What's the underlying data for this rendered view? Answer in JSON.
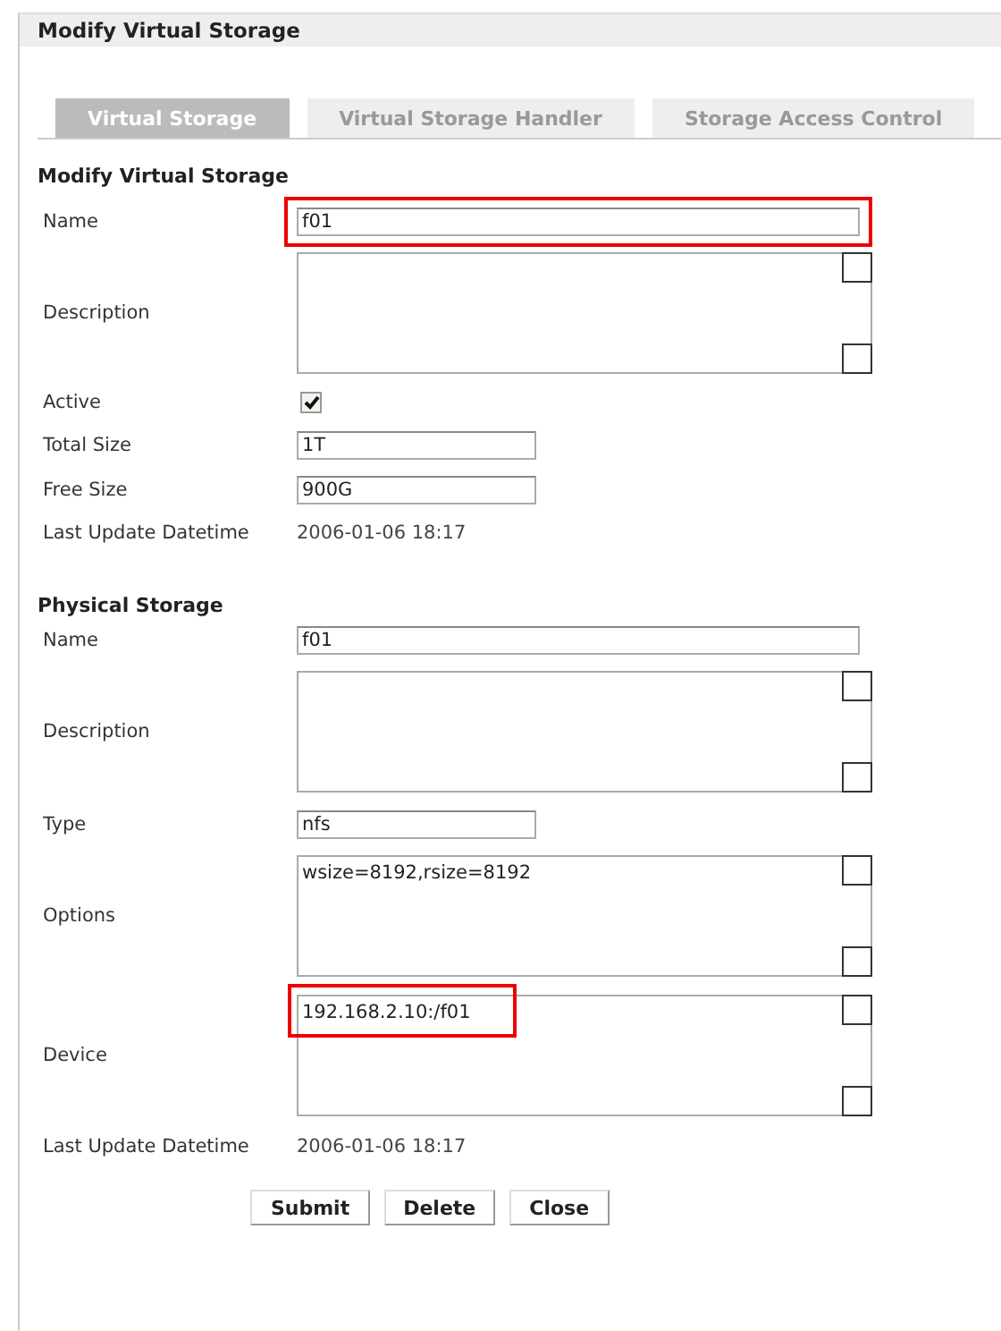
{
  "window": {
    "title": "Modify Virtual Storage"
  },
  "tabs": [
    {
      "label": "Virtual Storage",
      "selected": true
    },
    {
      "label": "Virtual Storage Handler",
      "selected": false
    },
    {
      "label": "Storage Access Control",
      "selected": false
    }
  ],
  "sections": [
    {
      "heading": "Modify Virtual Storage",
      "rows": [
        {
          "kind": "wide",
          "label": "Name",
          "value": "f01",
          "highlighted": true
        },
        {
          "kind": "area",
          "label": "Description",
          "value": "",
          "highlighted": false
        },
        {
          "kind": "check",
          "label": "Active",
          "checked": true
        },
        {
          "kind": "short",
          "label": "Total Size",
          "value": "1T",
          "highlighted": false
        },
        {
          "kind": "short",
          "label": "Free Size",
          "value": "900G",
          "highlighted": false
        },
        {
          "kind": "static",
          "label": "Last Update Datetime",
          "value": "2006-01-06 18:17"
        }
      ]
    },
    {
      "heading": "Physical Storage",
      "rows": [
        {
          "kind": "wide",
          "label": "Name",
          "value": "f01",
          "highlighted": false
        },
        {
          "kind": "area",
          "label": "Description",
          "value": "",
          "highlighted": false
        },
        {
          "kind": "short",
          "label": "Type",
          "value": "nfs",
          "highlighted": false
        },
        {
          "kind": "area",
          "label": "Options",
          "value": "wsize=8192,rsize=8192",
          "highlighted": false
        },
        {
          "kind": "area",
          "label": "Device",
          "value": "192.168.2.10:/f01",
          "highlighted": true
        },
        {
          "kind": "static",
          "label": "Last Update Datetime",
          "value": "2006-01-06 18:17"
        }
      ]
    }
  ],
  "buttons": [
    "Submit",
    "Delete",
    "Close"
  ]
}
